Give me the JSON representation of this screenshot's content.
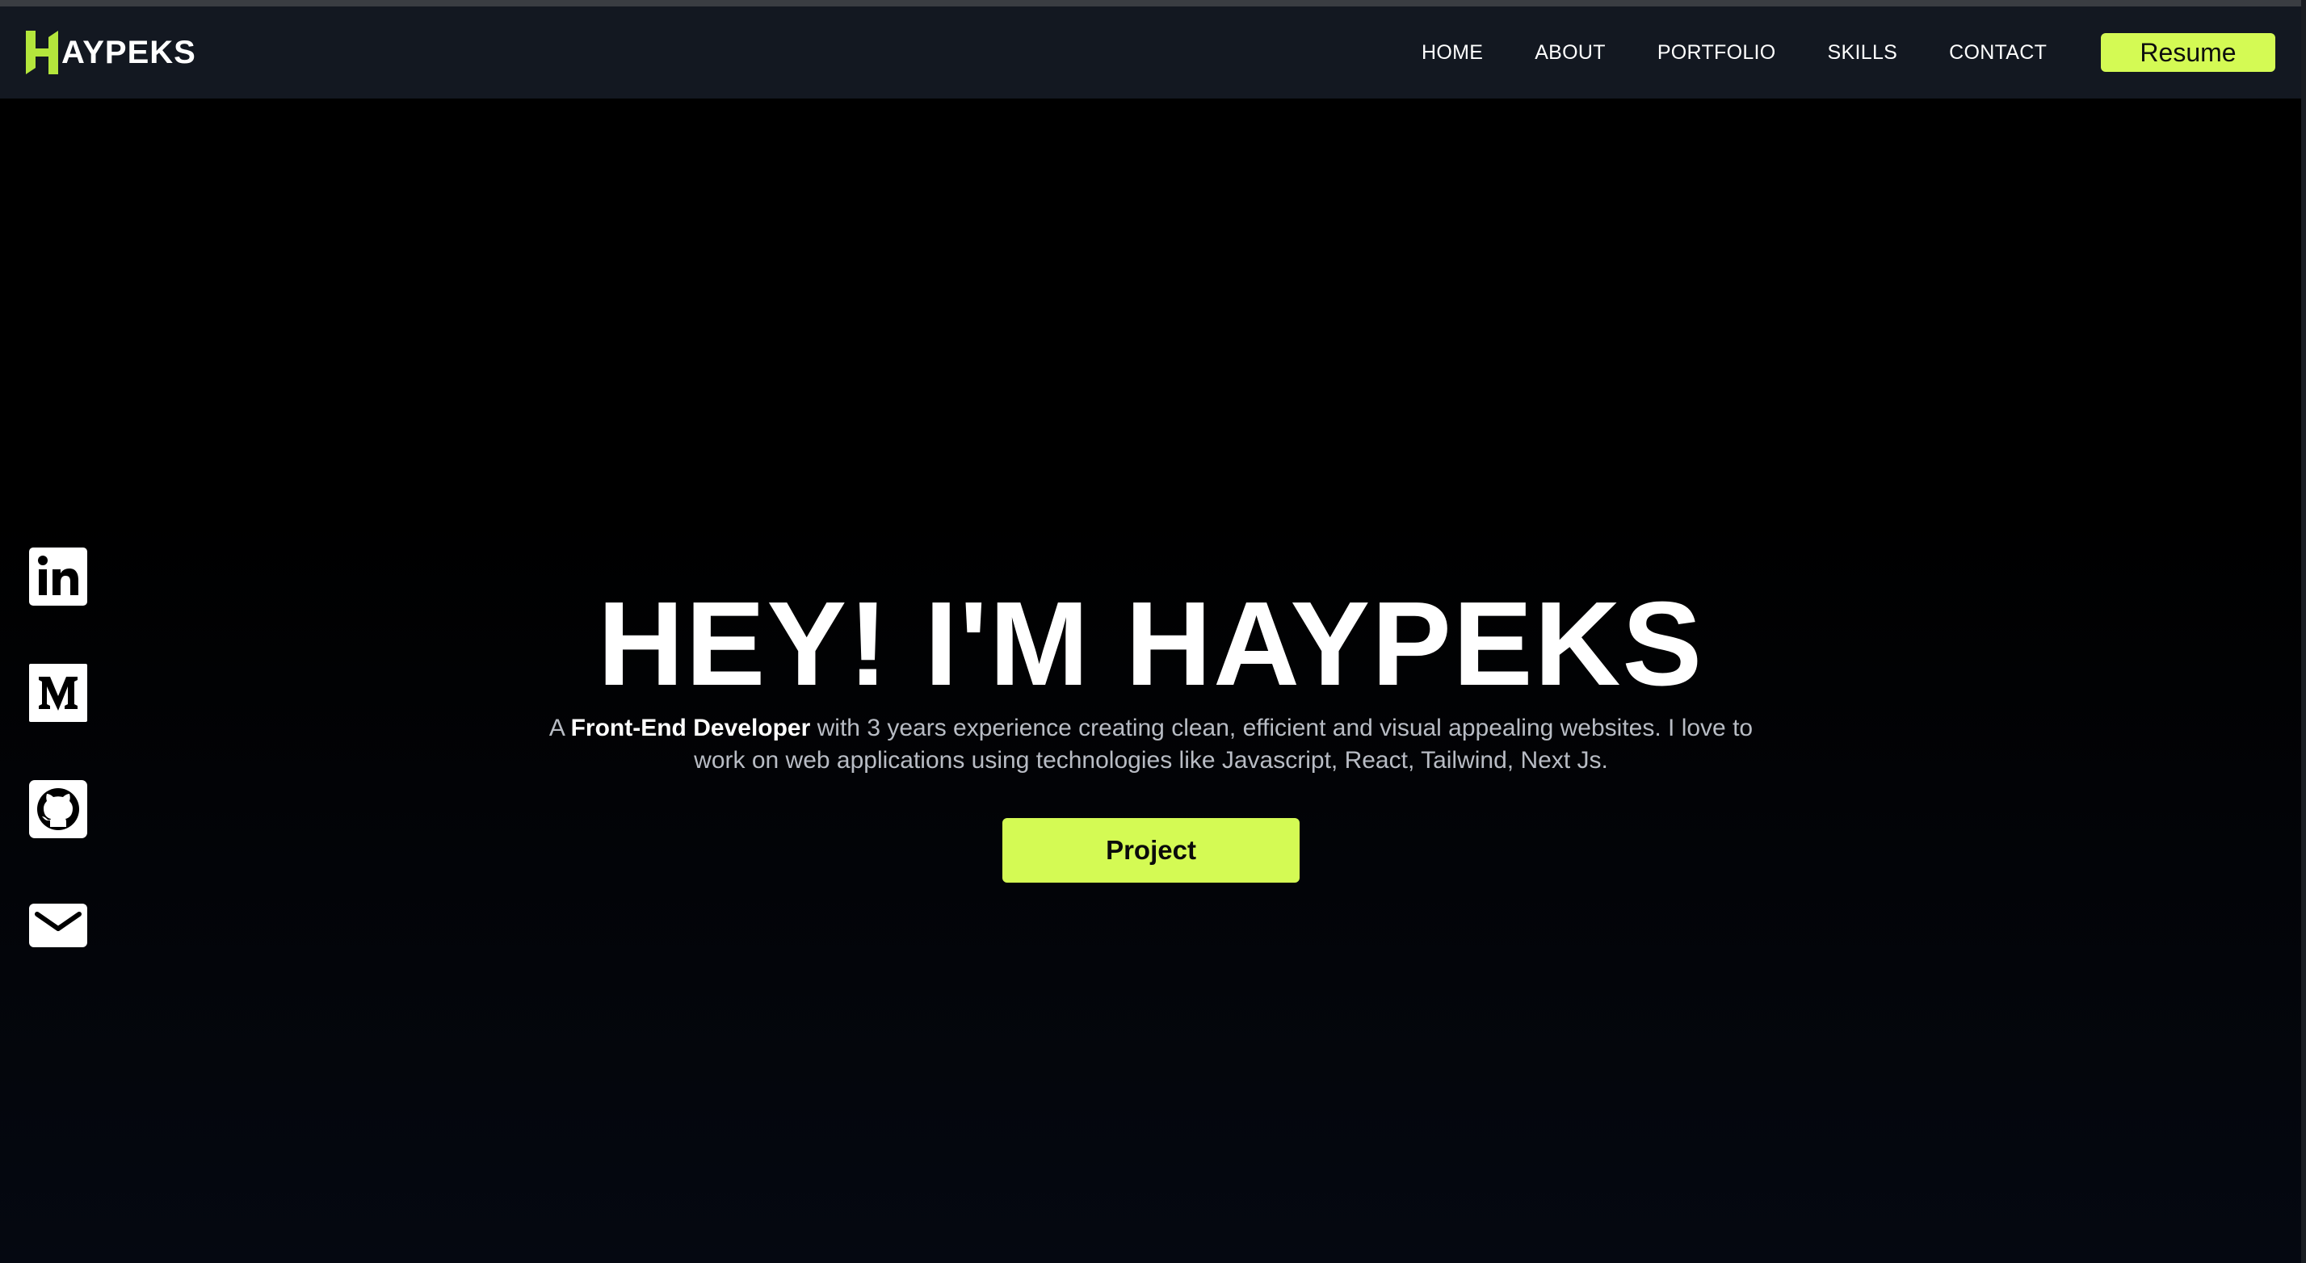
{
  "brand": {
    "name": "AYPEKS",
    "mark": "H",
    "accent_color": "#d4fa54"
  },
  "nav": {
    "links": [
      {
        "label": "HOME"
      },
      {
        "label": "ABOUT"
      },
      {
        "label": "PORTFOLIO"
      },
      {
        "label": "SKILLS"
      },
      {
        "label": "CONTACT"
      }
    ],
    "resume_label": "Resume"
  },
  "hero": {
    "title": "HEY! I'M HAYPEKS",
    "description_prefix": "A ",
    "description_role": "Front-End Developer",
    "description_rest": " with 3 years experience creating clean, efficient and visual appealing websites. I love to work on web applications using technologies like Javascript, React, Tailwind, Next Js.",
    "cta_label": "Project"
  },
  "socials": [
    {
      "icon": "linkedin-icon"
    },
    {
      "icon": "medium-icon"
    },
    {
      "icon": "github-icon"
    },
    {
      "icon": "mail-icon"
    }
  ]
}
